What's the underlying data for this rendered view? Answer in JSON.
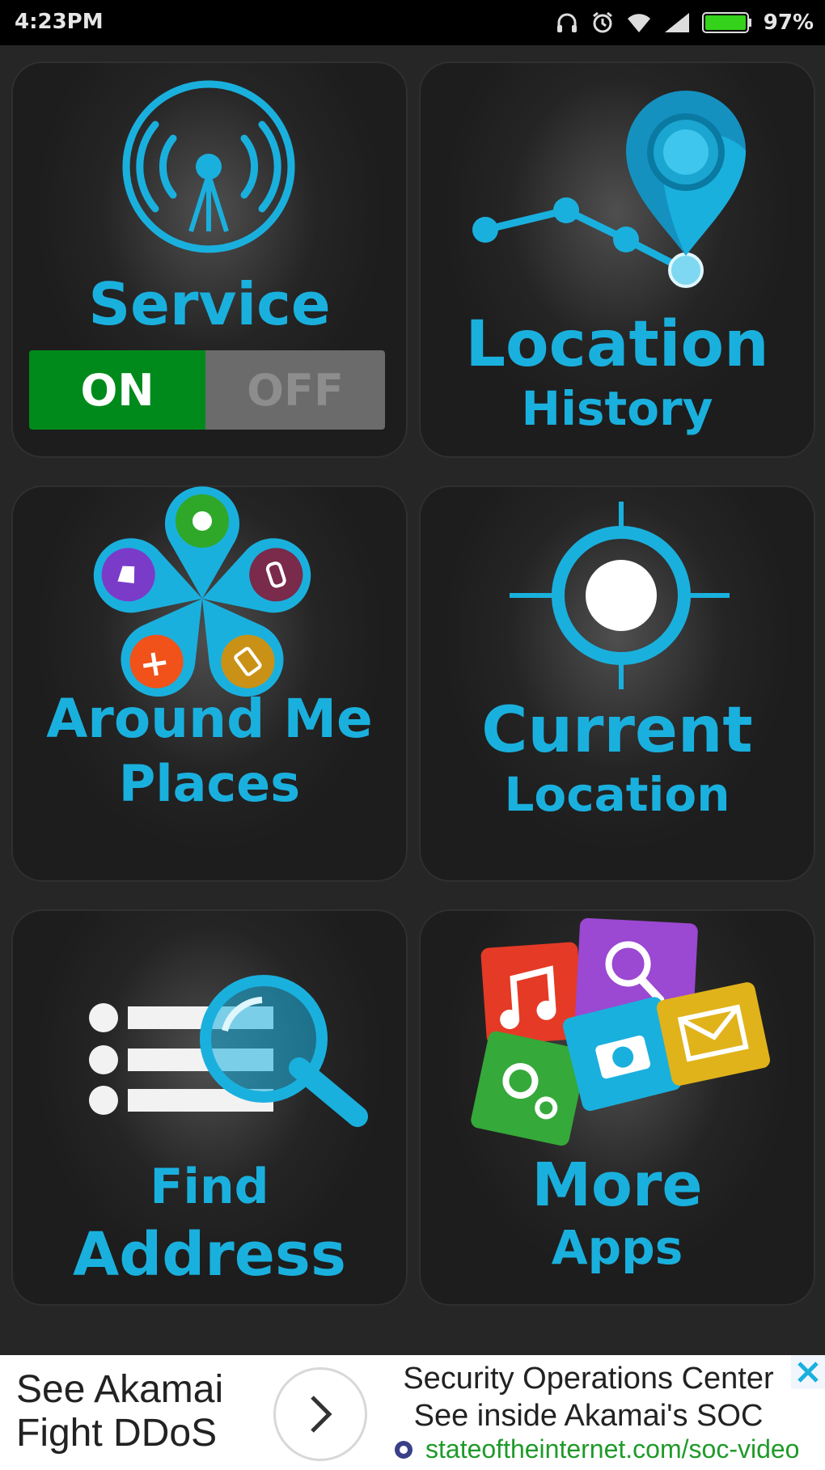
{
  "status_bar": {
    "time": "4:23PM",
    "battery_percent": "97%",
    "icons": [
      "headset-icon",
      "alarm-icon",
      "wifi-icon",
      "signal-icon",
      "battery-icon"
    ]
  },
  "tiles": {
    "service": {
      "title": "Service",
      "toggle_on": "ON",
      "toggle_off": "OFF",
      "icon": "broadcast-antenna-icon"
    },
    "location_history": {
      "line1": "Location",
      "line2": "History",
      "icon": "map-pin-route-icon"
    },
    "around_me": {
      "line1": "Around Me",
      "line2": "Places",
      "icon": "places-cluster-icon"
    },
    "current_location": {
      "line1": "Current",
      "line2": "Location",
      "icon": "crosshair-icon"
    },
    "find_address": {
      "line1": "Find",
      "line2": "Address",
      "icon": "list-magnifier-icon"
    },
    "more_apps": {
      "line1": "More",
      "line2": "Apps",
      "icon": "apps-collage-icon"
    }
  },
  "ad": {
    "left_line1": "See Akamai",
    "left_line2": "Fight DDoS",
    "headline": "Security Operations Center",
    "subline": "See inside Akamai's SOC",
    "url": "stateoftheinternet.com/soc-video"
  },
  "colors": {
    "accent": "#1ab0de",
    "toggle_on": "#008a1c",
    "toggle_off": "#6b6b6b",
    "background": "#262626"
  }
}
